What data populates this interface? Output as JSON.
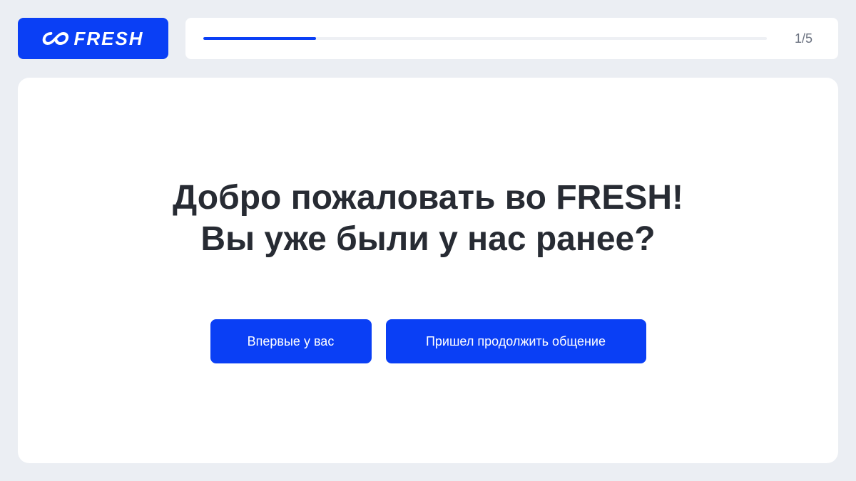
{
  "brand": {
    "name": "FRESH",
    "logo_icon": "infinity-icon",
    "color": "#0a3ff5"
  },
  "progress": {
    "current": 1,
    "total": 5,
    "label": "1/5",
    "fraction": 0.2
  },
  "welcome": {
    "title_line1": "Добро пожаловать во FRESH!",
    "title_line2": "Вы уже были у нас ранее?"
  },
  "actions": {
    "first_time_label": "Впервые у вас",
    "returning_label": "Пришел продолжить общение"
  },
  "colors": {
    "accent": "#0a3ff5",
    "background": "#ebeef3",
    "text": "#272b33",
    "muted": "#6b7280"
  }
}
